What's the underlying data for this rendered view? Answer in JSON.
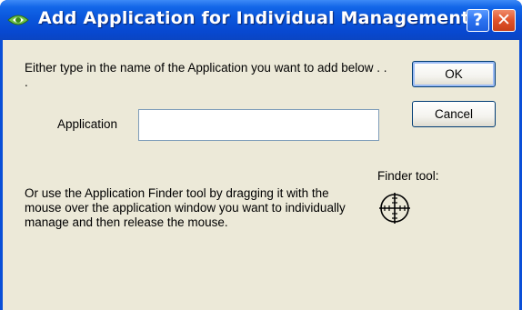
{
  "window": {
    "title": "Add Application for Individual Management",
    "help_glyph": "?",
    "close_glyph": "✕"
  },
  "dialog": {
    "instruction": "Either type in the name of the Application you want to add below . . .",
    "application_label": "Application",
    "application_value": "",
    "application_placeholder": "",
    "finder_label": "Finder tool:",
    "finder_instruction": "Or use the Application Finder tool by dragging it with the mouse over the application window you want to individually manage and then release the mouse."
  },
  "buttons": {
    "ok": "OK",
    "cancel": "Cancel"
  },
  "icons": {
    "app": "nvidia-eye-icon",
    "finder": "crosshair-target-icon"
  }
}
